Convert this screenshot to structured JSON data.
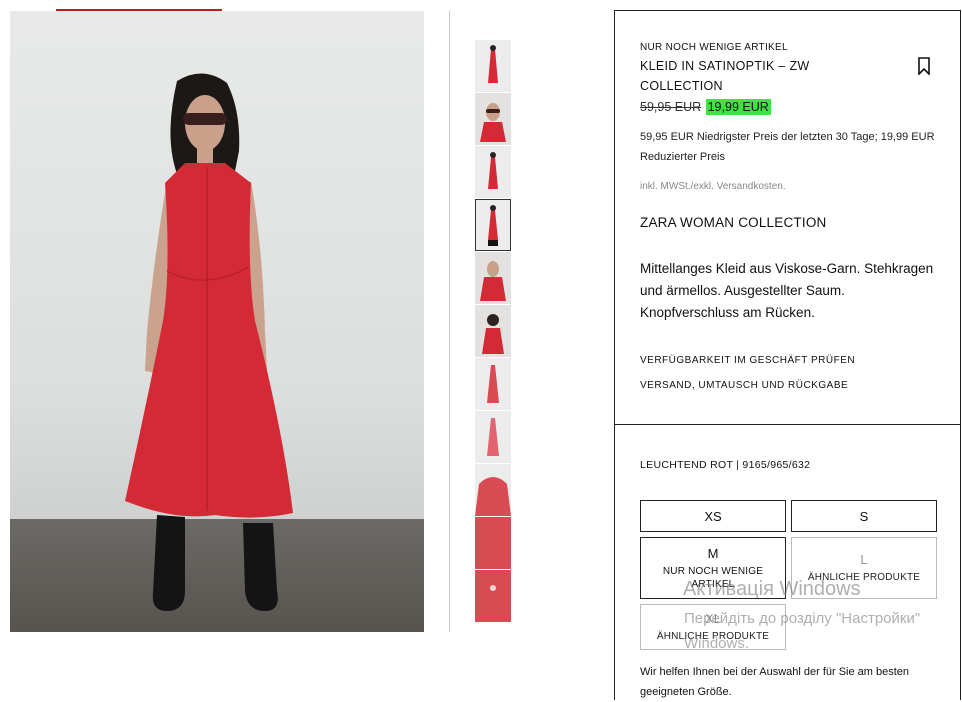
{
  "product": {
    "availability_badge": "NUR NOCH WENIGE ARTIKEL",
    "title_line1": "KLEID IN SATINOPTIK – ZW",
    "title_line2": "COLLECTION",
    "old_price": "59,95 EUR",
    "new_price": "19,99 EUR",
    "price_note": "59,95 EUR Niedrigster Preis der letzten 30 Tage; 19,99 EUR Reduzierter Preis",
    "tax_note": "inkl. MWSt./exkl. Versandkosten.",
    "collection": "ZARA WOMAN COLLECTION",
    "description": "Mittellanges Kleid aus Viskose-Garn. Stehkragen und ärmellos. Ausgestellter Saum. Knopfverschluss am Rücken.",
    "links": {
      "store_availability": "VERFÜGBARKEIT IM GESCHÄFT PRÜFEN",
      "shipping": "VERSAND, UMTAUSCH UND RÜCKGABE"
    },
    "color_ref": "LEUCHTEND ROT | 9165/965/632",
    "sizes": [
      {
        "label": "XS",
        "sub": "",
        "available": true
      },
      {
        "label": "S",
        "sub": "",
        "available": true
      },
      {
        "label": "M",
        "sub": "NUR NOCH WENIGE ARTIKEL",
        "available": true
      },
      {
        "label": "L",
        "sub": "ÄHNLICHE PRODUKTE",
        "available": false
      },
      {
        "label": "XL",
        "sub": "ÄHNLICHE PRODUKTE",
        "available": false
      }
    ],
    "size_help": "Wir helfen Ihnen bei der Auswahl der für Sie am besten geeigneten Größe."
  },
  "thumbnails": [
    "front",
    "portrait",
    "side",
    "full-dark",
    "seated",
    "back",
    "product-flat",
    "product-flat-2",
    "detail-collar",
    "detail-fabric",
    "detail-button"
  ],
  "colors": {
    "dress_red": "#d42a35",
    "price_highlight": "#3ce63c",
    "accent": "#b91d1d"
  },
  "watermark": {
    "line1": "Активація Windows",
    "line2": "Перейдіть до розділу \"Настройки\"",
    "line3": "Windows."
  }
}
